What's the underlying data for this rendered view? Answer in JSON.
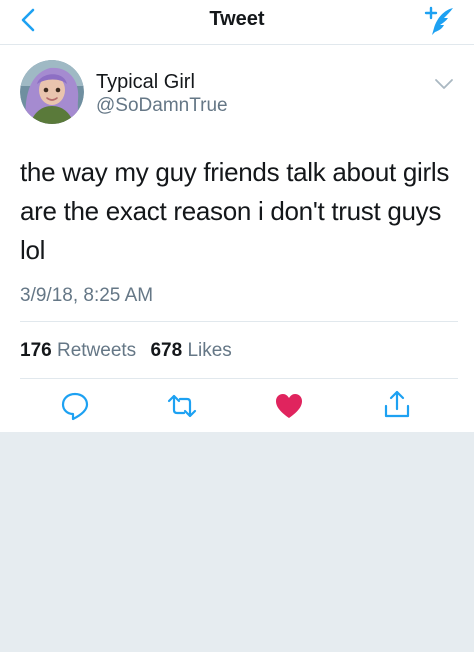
{
  "nav": {
    "title": "Tweet",
    "back_icon": "chevron-left-icon",
    "compose_icon": "compose-tweet-icon"
  },
  "tweet": {
    "author": {
      "display_name": "Typical Girl",
      "handle": "@SoDamnTrue"
    },
    "text": "the way my guy friends talk about girls are the exact reason i don't trust guys lol",
    "timestamp": "3/9/18, 8:25 AM",
    "stats": {
      "retweets_count": "176",
      "retweets_label": "Retweets",
      "likes_count": "678",
      "likes_label": "Likes"
    },
    "actions": [
      "reply-icon",
      "retweet-icon",
      "like-icon",
      "share-icon"
    ]
  },
  "colors": {
    "accent": "#1da1f2",
    "secondary_text": "#657786",
    "like": "#e0245e",
    "background": "#e6ecf0"
  }
}
